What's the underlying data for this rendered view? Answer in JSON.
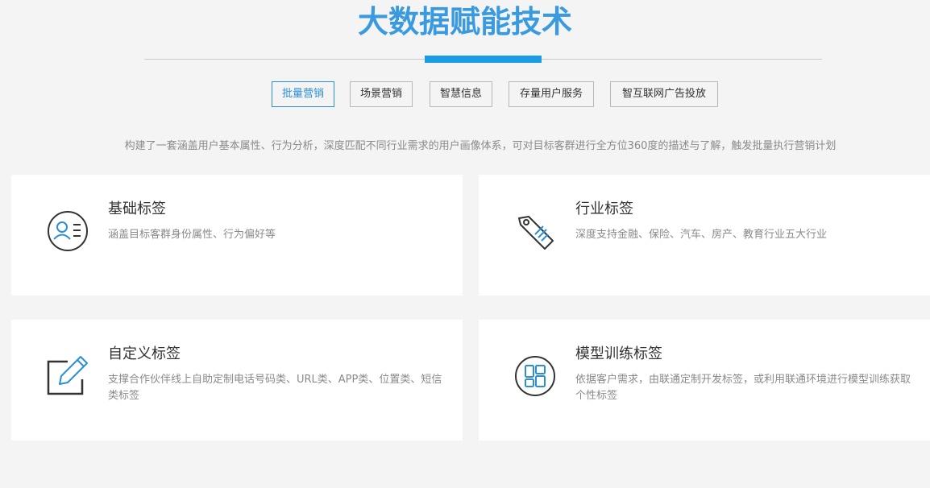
{
  "header": {
    "title": "大数据赋能技术"
  },
  "tabs": [
    {
      "label": "批量营销",
      "active": true
    },
    {
      "label": "场景营销",
      "active": false
    },
    {
      "label": "智慧信息",
      "active": false
    },
    {
      "label": "存量用户服务",
      "active": false
    },
    {
      "label": "智互联网广告投放",
      "active": false
    }
  ],
  "description": "构建了一套涵盖用户基本属性、行为分析，深度匹配不同行业需求的用户画像体系，可对目标客群进行全方位360度的描述与了解，触发批量执行营销计划",
  "cards": [
    {
      "icon": "user-profile-icon",
      "title": "基础标签",
      "text": "涵盖目标客群身份属性、行为偏好等"
    },
    {
      "icon": "tag-icon",
      "title": "行业标签",
      "text": "深度支持金融、保险、汽车、房产、教育行业五大行业"
    },
    {
      "icon": "edit-icon",
      "title": "自定义标签",
      "text": "支撑合作伙伴线上自助定制电话号码类、URL类、APP类、位置类、短信类标签"
    },
    {
      "icon": "model-grid-icon",
      "title": "模型训练标签",
      "text": "依据客户需求，由联通定制开发标签，或利用联通环境进行模型训练获取个性标签"
    }
  ],
  "colors": {
    "accent": "#1a9be6",
    "title": "#3a9ae0",
    "icon_dark": "#333333",
    "icon_blue": "#2a8fd6",
    "background": "#f4f4f5",
    "card": "#ffffff"
  }
}
